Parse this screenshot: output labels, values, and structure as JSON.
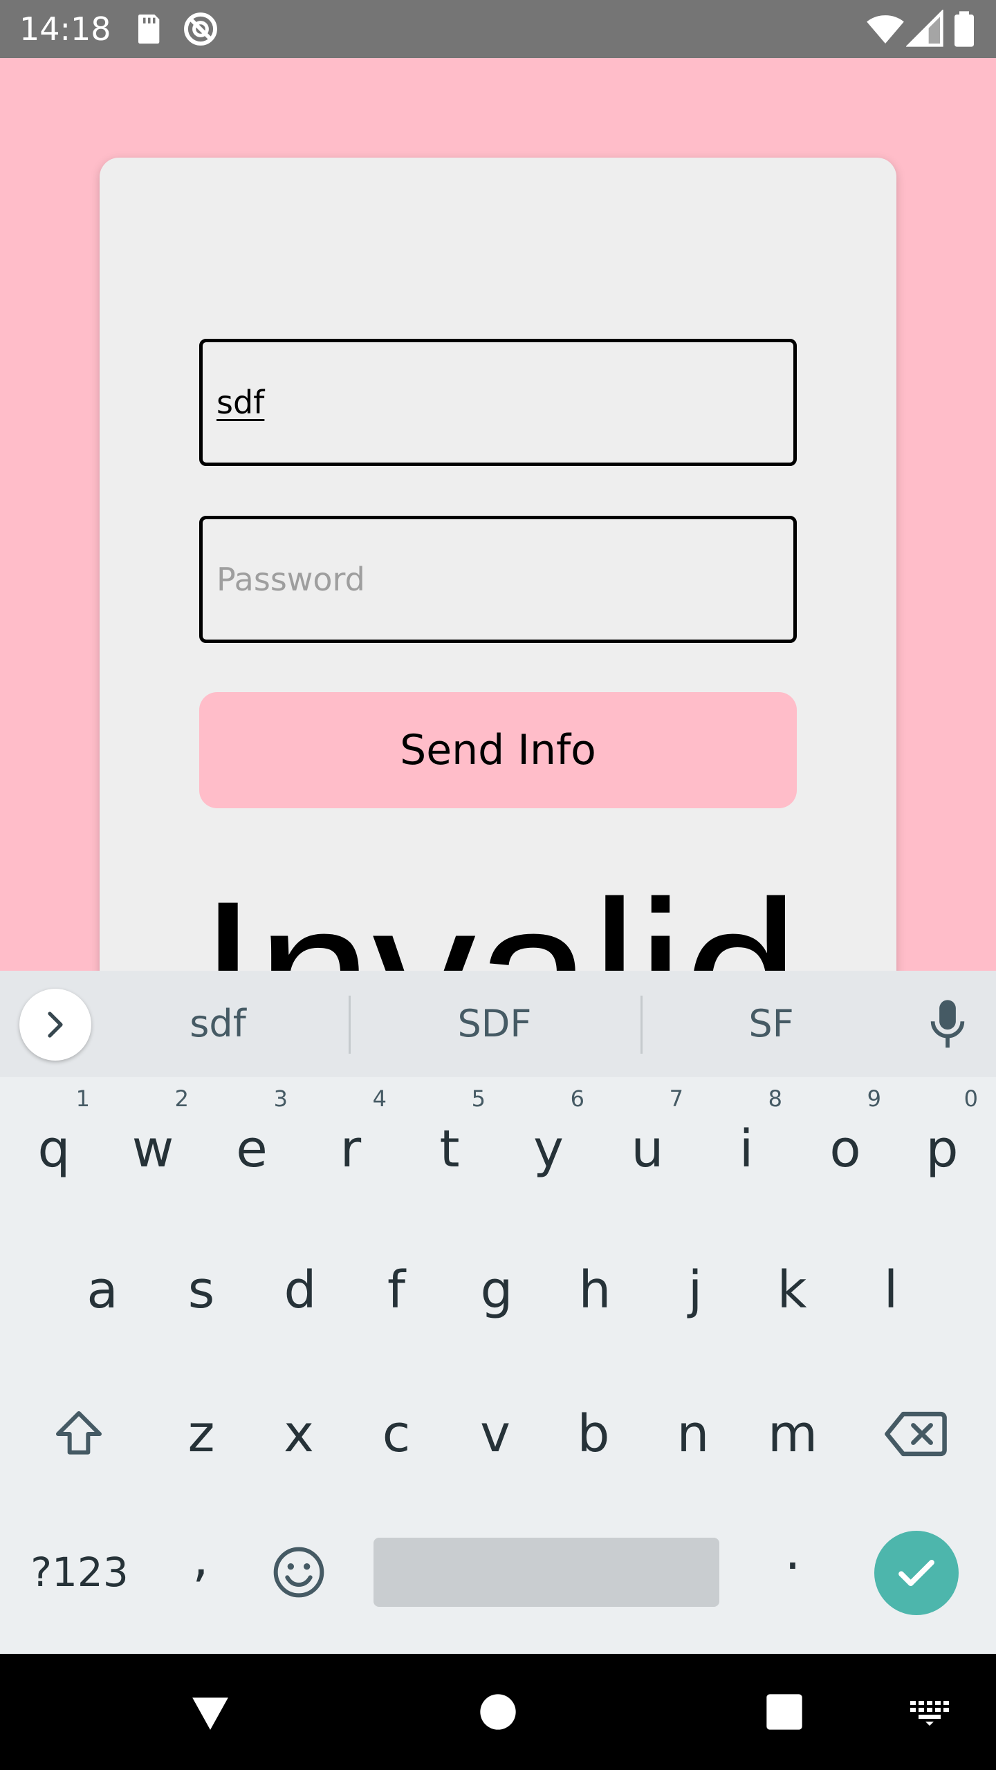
{
  "status_bar": {
    "time": "14:18",
    "icons": [
      "sd-card-icon",
      "do-not-disturb-icon",
      "wifi-icon",
      "signal-icon",
      "battery-icon"
    ]
  },
  "form": {
    "username_value": "sdf",
    "password_placeholder": "Password",
    "send_button_label": "Send Info",
    "result_text": "Invalid"
  },
  "keyboard": {
    "suggestions": [
      "sdf",
      "SDF",
      "SF"
    ],
    "row1": [
      {
        "key": "q",
        "hint": "1"
      },
      {
        "key": "w",
        "hint": "2"
      },
      {
        "key": "e",
        "hint": "3"
      },
      {
        "key": "r",
        "hint": "4"
      },
      {
        "key": "t",
        "hint": "5"
      },
      {
        "key": "y",
        "hint": "6"
      },
      {
        "key": "u",
        "hint": "7"
      },
      {
        "key": "i",
        "hint": "8"
      },
      {
        "key": "o",
        "hint": "9"
      },
      {
        "key": "p",
        "hint": "0"
      }
    ],
    "row2": [
      "a",
      "s",
      "d",
      "f",
      "g",
      "h",
      "j",
      "k",
      "l"
    ],
    "row3": [
      "z",
      "x",
      "c",
      "v",
      "b",
      "n",
      "m"
    ],
    "symbols_label": "?123",
    "comma_label": ",",
    "period_label": "."
  },
  "colors": {
    "background": "#FFBDC9",
    "card": "#EEEEEE",
    "button": "#FFBDC9",
    "enter_key": "#4DB6AC"
  }
}
